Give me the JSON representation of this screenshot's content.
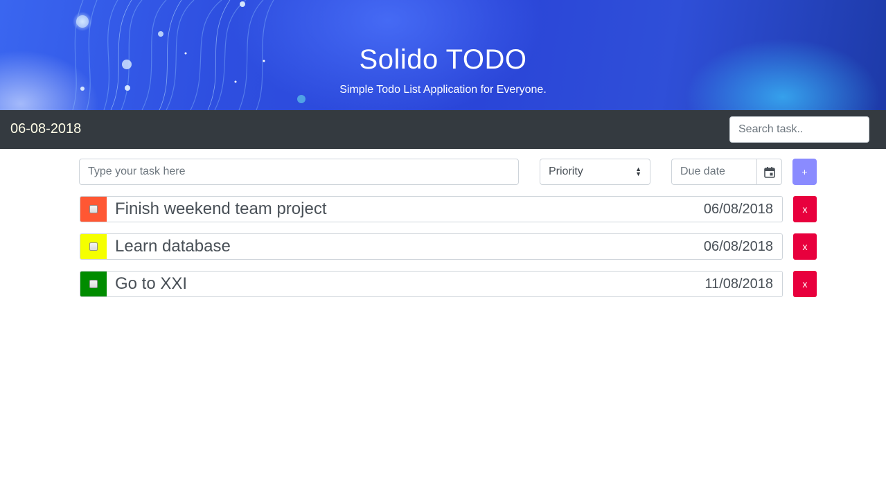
{
  "banner": {
    "title": "Solido TODO",
    "subtitle": "Simple Todo List Application for Everyone."
  },
  "navbar": {
    "date": "06-08-2018",
    "search_placeholder": "Search task.."
  },
  "add_form": {
    "task_placeholder": "Type your task here",
    "priority_label": "Priority",
    "due_placeholder": "Due date",
    "calendar_icon": "calendar-icon",
    "add_label": "+"
  },
  "tasks": [
    {
      "text": "Finish weekend team project",
      "date": "06/08/2018",
      "priority_color": "#ff5733",
      "delete_label": "x"
    },
    {
      "text": "Learn database",
      "date": "06/08/2018",
      "priority_color": "#f5ff00",
      "delete_label": "x"
    },
    {
      "text": "Go to XXI",
      "date": "11/08/2018",
      "priority_color": "#008c00",
      "delete_label": "x"
    }
  ],
  "colors": {
    "navbar_bg": "#343a40",
    "add_button": "#8a8bff",
    "delete_button": "#e8003d"
  }
}
